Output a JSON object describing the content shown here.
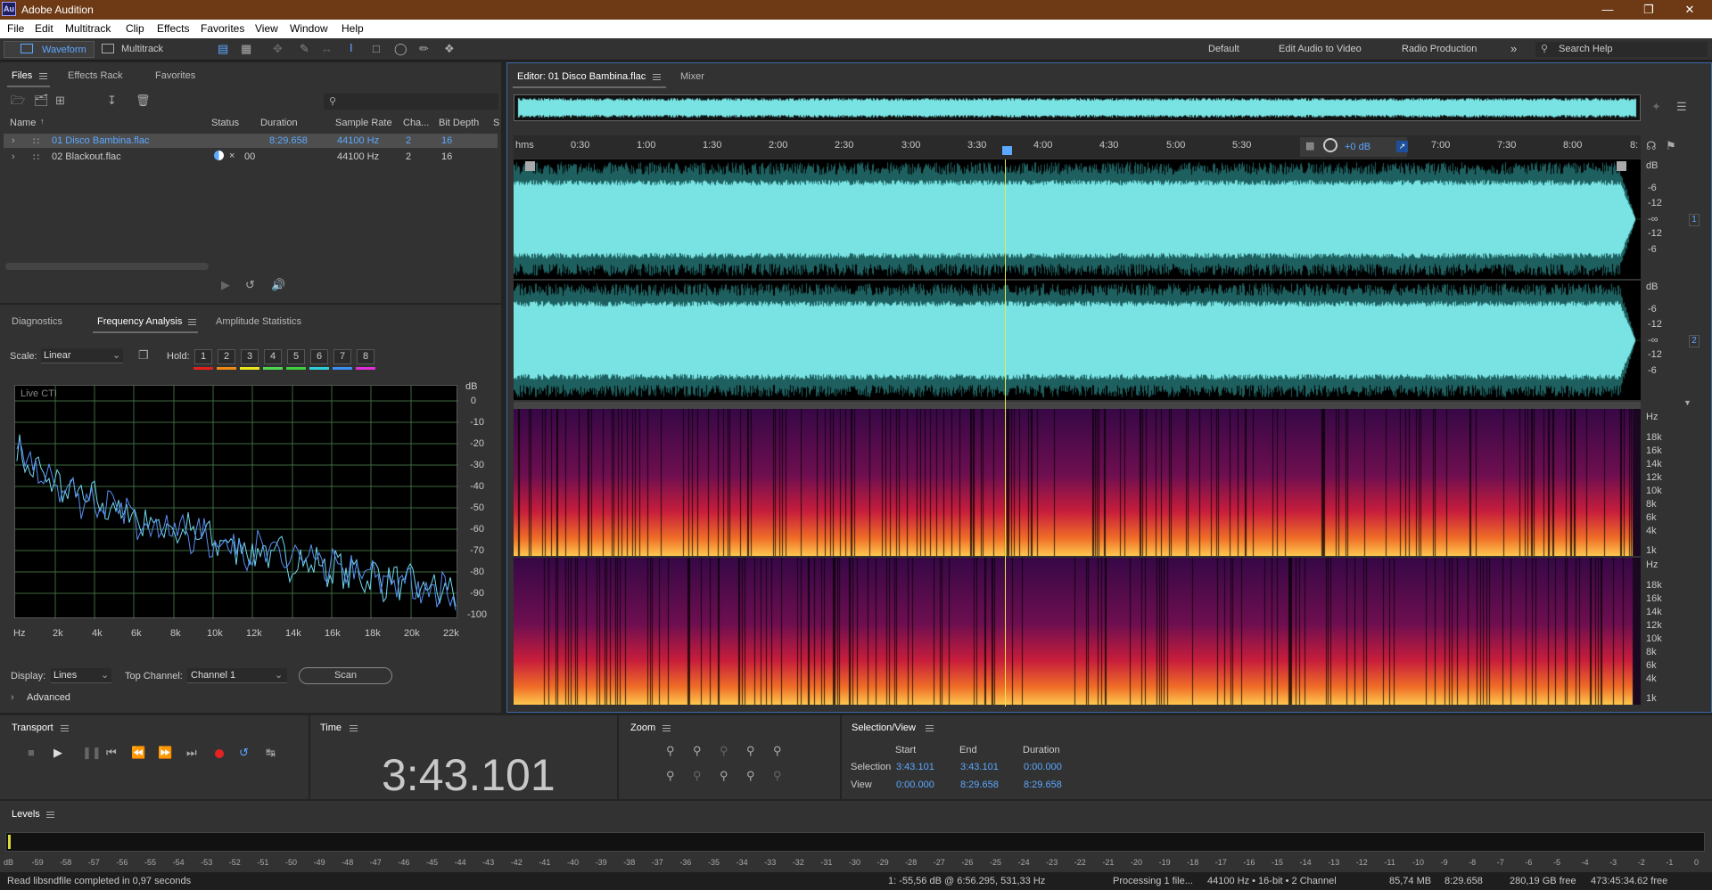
{
  "app": {
    "title": "Adobe Audition",
    "logo": "Au"
  },
  "menu": [
    "File",
    "Edit",
    "Multitrack",
    "Clip",
    "Effects",
    "Favorites",
    "View",
    "Window",
    "Help"
  ],
  "toolbar": {
    "waveform": "Waveform",
    "multitrack": "Multitrack",
    "workspaces": [
      "Default",
      "Edit Audio to Video",
      "Radio Production"
    ],
    "search_placeholder": "Search Help"
  },
  "files": {
    "tabs": [
      "Files",
      "Effects Rack",
      "Favorites"
    ],
    "columns": [
      "Name",
      "Status",
      "Duration",
      "Sample Rate",
      "Cha...",
      "Bit Depth",
      "S"
    ],
    "rows": [
      {
        "name": "01 Disco Bambina.flac",
        "status": "",
        "duration": "8:29.658",
        "rate": "44100 Hz",
        "ch": "2",
        "bits": "16"
      },
      {
        "name": "02 Blackout.flac",
        "status": "00",
        "duration": "",
        "rate": "44100 Hz",
        "ch": "2",
        "bits": "16"
      }
    ]
  },
  "analysis": {
    "tabs": [
      "Diagnostics",
      "Frequency Analysis",
      "Amplitude Statistics"
    ],
    "scale_label": "Scale:",
    "scale_value": "Linear",
    "hold_label": "Hold:",
    "holds": [
      "1",
      "2",
      "3",
      "4",
      "5",
      "6",
      "7",
      "8"
    ],
    "hold_colors": [
      "#e31e1e",
      "#ef8a16",
      "#e8e81c",
      "#4fd84f",
      "#3ecf3e",
      "#2ed0d8",
      "#3a8ff0",
      "#e02ed8"
    ],
    "live": "Live CTI",
    "db_unit": "dB",
    "db_ticks": [
      "0",
      "-10",
      "-20",
      "-30",
      "-40",
      "-50",
      "-60",
      "-70",
      "-80",
      "-90",
      "-100"
    ],
    "hz_ticks": [
      "Hz",
      "2k",
      "4k",
      "6k",
      "8k",
      "10k",
      "12k",
      "14k",
      "16k",
      "18k",
      "20k",
      "22k"
    ],
    "display_label": "Display:",
    "display_value": "Lines",
    "top_channel_label": "Top Channel:",
    "top_channel_value": "Channel 1",
    "scan": "Scan",
    "advanced": "Advanced"
  },
  "editor": {
    "tab": "Editor: 01 Disco Bambina.flac",
    "mixer": "Mixer",
    "ruler": [
      "hms",
      "0:30",
      "1:00",
      "1:30",
      "2:00",
      "2:30",
      "3:00",
      "3:30",
      "4:00",
      "4:30",
      "5:00",
      "5:30",
      "7:00",
      "7:30",
      "8:00",
      "8:"
    ],
    "gain": "+0 dB",
    "db_unit": "dB",
    "db_scale": [
      "-6",
      "-12",
      "-∞",
      "-12",
      "-6"
    ],
    "channel_1": "1",
    "channel_2": "2",
    "hz_unit": "Hz",
    "hz_scale": [
      "18k",
      "16k",
      "14k",
      "12k",
      "10k",
      "8k",
      "6k",
      "4k",
      "1k"
    ]
  },
  "transport": {
    "title": "Transport"
  },
  "time": {
    "title": "Time",
    "value": "3:43.101"
  },
  "zoom": {
    "title": "Zoom"
  },
  "selection": {
    "title": "Selection/View",
    "headers": [
      "Start",
      "End",
      "Duration"
    ],
    "rows": [
      {
        "label": "Selection",
        "start": "3:43.101",
        "end": "3:43.101",
        "duration": "0:00.000"
      },
      {
        "label": "View",
        "start": "0:00.000",
        "end": "8:29.658",
        "duration": "8:29.658"
      }
    ]
  },
  "levels": {
    "title": "Levels",
    "scale": [
      "dB",
      "-59",
      "-58",
      "-57",
      "-56",
      "-55",
      "-54",
      "-53",
      "-52",
      "-51",
      "-50",
      "-49",
      "-48",
      "-47",
      "-46",
      "-45",
      "-44",
      "-43",
      "-42",
      "-41",
      "-40",
      "-39",
      "-38",
      "-37",
      "-36",
      "-35",
      "-34",
      "-33",
      "-32",
      "-31",
      "-30",
      "-29",
      "-28",
      "-27",
      "-26",
      "-25",
      "-24",
      "-23",
      "-22",
      "-21",
      "-20",
      "-19",
      "-18",
      "-17",
      "-16",
      "-15",
      "-14",
      "-13",
      "-12",
      "-11",
      "-10",
      "-9",
      "-8",
      "-7",
      "-6",
      "-5",
      "-4",
      "-3",
      "-2",
      "-1",
      "0"
    ]
  },
  "status": {
    "left": "Read libsndfile completed in 0,97 seconds",
    "cursor": "1: -55,56 dB @ 6:56.295, 531,33 Hz",
    "processing": "Processing 1 file...",
    "format": "44100 Hz • 16-bit • 2 Channel",
    "size": "85,74 MB",
    "duration": "8:29.658",
    "free": "280,19 GB free",
    "free_time": "473:45:34.62 free"
  },
  "colors": {
    "accent": "#5ca8ff",
    "waveform": "#79e3e3",
    "playhead": "#e8e84a",
    "titlebar": "#6e3a15"
  }
}
